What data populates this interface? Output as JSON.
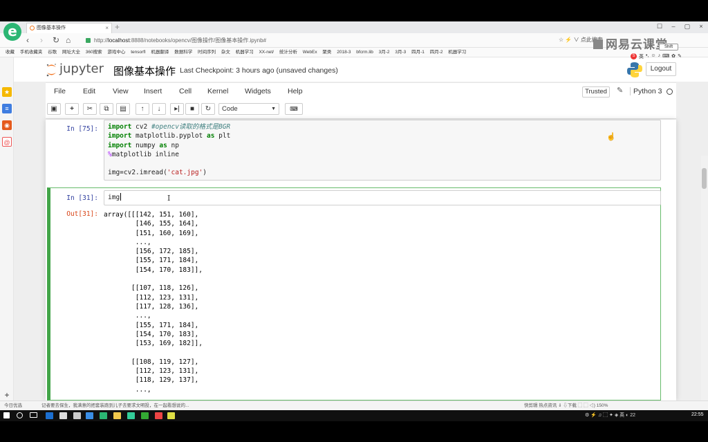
{
  "browser": {
    "tab_title": "图像基本操作",
    "tab_close": "×",
    "new_tab": "+",
    "window_buttons": [
      "☐",
      "–",
      "▢",
      "×"
    ],
    "url_prefix": "http://",
    "url_host": "localhost",
    "url_path": ":8888/notebooks/opencv/图像操作/图像基本操作.ipynb#",
    "addr_right": "☆  ⚡ ∨   点此搜索",
    "shift_label": "Shift",
    "ime_label": "英",
    "bookmarks": [
      "收藏",
      "手机收藏夹",
      "谷歌",
      "网址大全",
      "360搜索",
      "游戏中心",
      "tensorfl",
      "机器翻译",
      "数据科学",
      "时间序列",
      "杂文",
      "机器学习",
      "XX-net/",
      "统计分析",
      "WebEx",
      "聚类",
      "2018-3",
      "bfcrm.lib",
      "3月-2",
      "3月-3",
      "四月-1",
      "四月-2",
      "机器学习"
    ]
  },
  "watermark": "网易云课堂",
  "notebook": {
    "logo_text": "jupyter",
    "name": "图像基本操作",
    "checkpoint": "Last Checkpoint: 3 hours ago (unsaved changes)",
    "logout": "Logout",
    "menu": [
      "File",
      "Edit",
      "View",
      "Insert",
      "Cell",
      "Kernel",
      "Widgets",
      "Help"
    ],
    "trusted": "Trusted",
    "kernel": "Python 3",
    "cell_type": "Code",
    "toolbar_icons": [
      "save-icon",
      "plus-icon",
      "scissors-icon",
      "copy-icon",
      "paste-icon",
      "arrow-up-icon",
      "arrow-down-icon",
      "step-forward-icon",
      "stop-icon",
      "restart-icon",
      "keyboard-icon"
    ]
  },
  "cells": {
    "cell1": {
      "prompt": "In [75]:",
      "lines": [
        {
          "kw": "import",
          "rest": " cv2 ",
          "comment": "#opencv读取的格式是BGR"
        },
        {
          "kw": "import",
          "rest": " matplotlib.pyplot ",
          "kw2": "as",
          "rest2": " plt"
        },
        {
          "kw": "import",
          "rest": " numpy ",
          "kw2": "as",
          "rest2": " np"
        },
        {
          "magic": "%",
          "rest": "matplotlib inline"
        },
        {
          "blank": ""
        },
        {
          "pre": "img=cv2.imread(",
          "str": "'cat.jpg'",
          "post": ")"
        }
      ]
    },
    "cell2": {
      "prompt": "In [31]:",
      "code": "img",
      "out_prompt": "Out[31]:",
      "output": "array([[[142, 151, 160],\n        [146, 155, 164],\n        [151, 160, 169],\n        ...,\n        [156, 172, 185],\n        [155, 171, 184],\n        [154, 170, 183]],\n\n       [[107, 118, 126],\n        [112, 123, 131],\n        [117, 128, 136],\n        ...,\n        [155, 171, 184],\n        [154, 170, 183],\n        [153, 169, 182]],\n\n       [[108, 119, 127],\n        [112, 123, 131],\n        [118, 129, 137],\n        ...,"
    }
  },
  "statusbar": {
    "left": "今日优选",
    "news": "记者要去保生，我满意的把套装跑到儿子去要求文明投，在一起看想说的...",
    "right": "快剪辑    热点资讯    ⇓    ⇩下载    ⬚    ⬚    ◁)    150%"
  },
  "taskbar": {
    "tray": "⚙ ⚡ ♫ ⬚ ✦ ◈ 英 ◐ 22",
    "clock": "22:55"
  },
  "colors": {
    "accent_green": "#42a548",
    "prompt_in": "#303f9f",
    "prompt_out": "#d84315",
    "browser_brand": "#2bb673"
  }
}
